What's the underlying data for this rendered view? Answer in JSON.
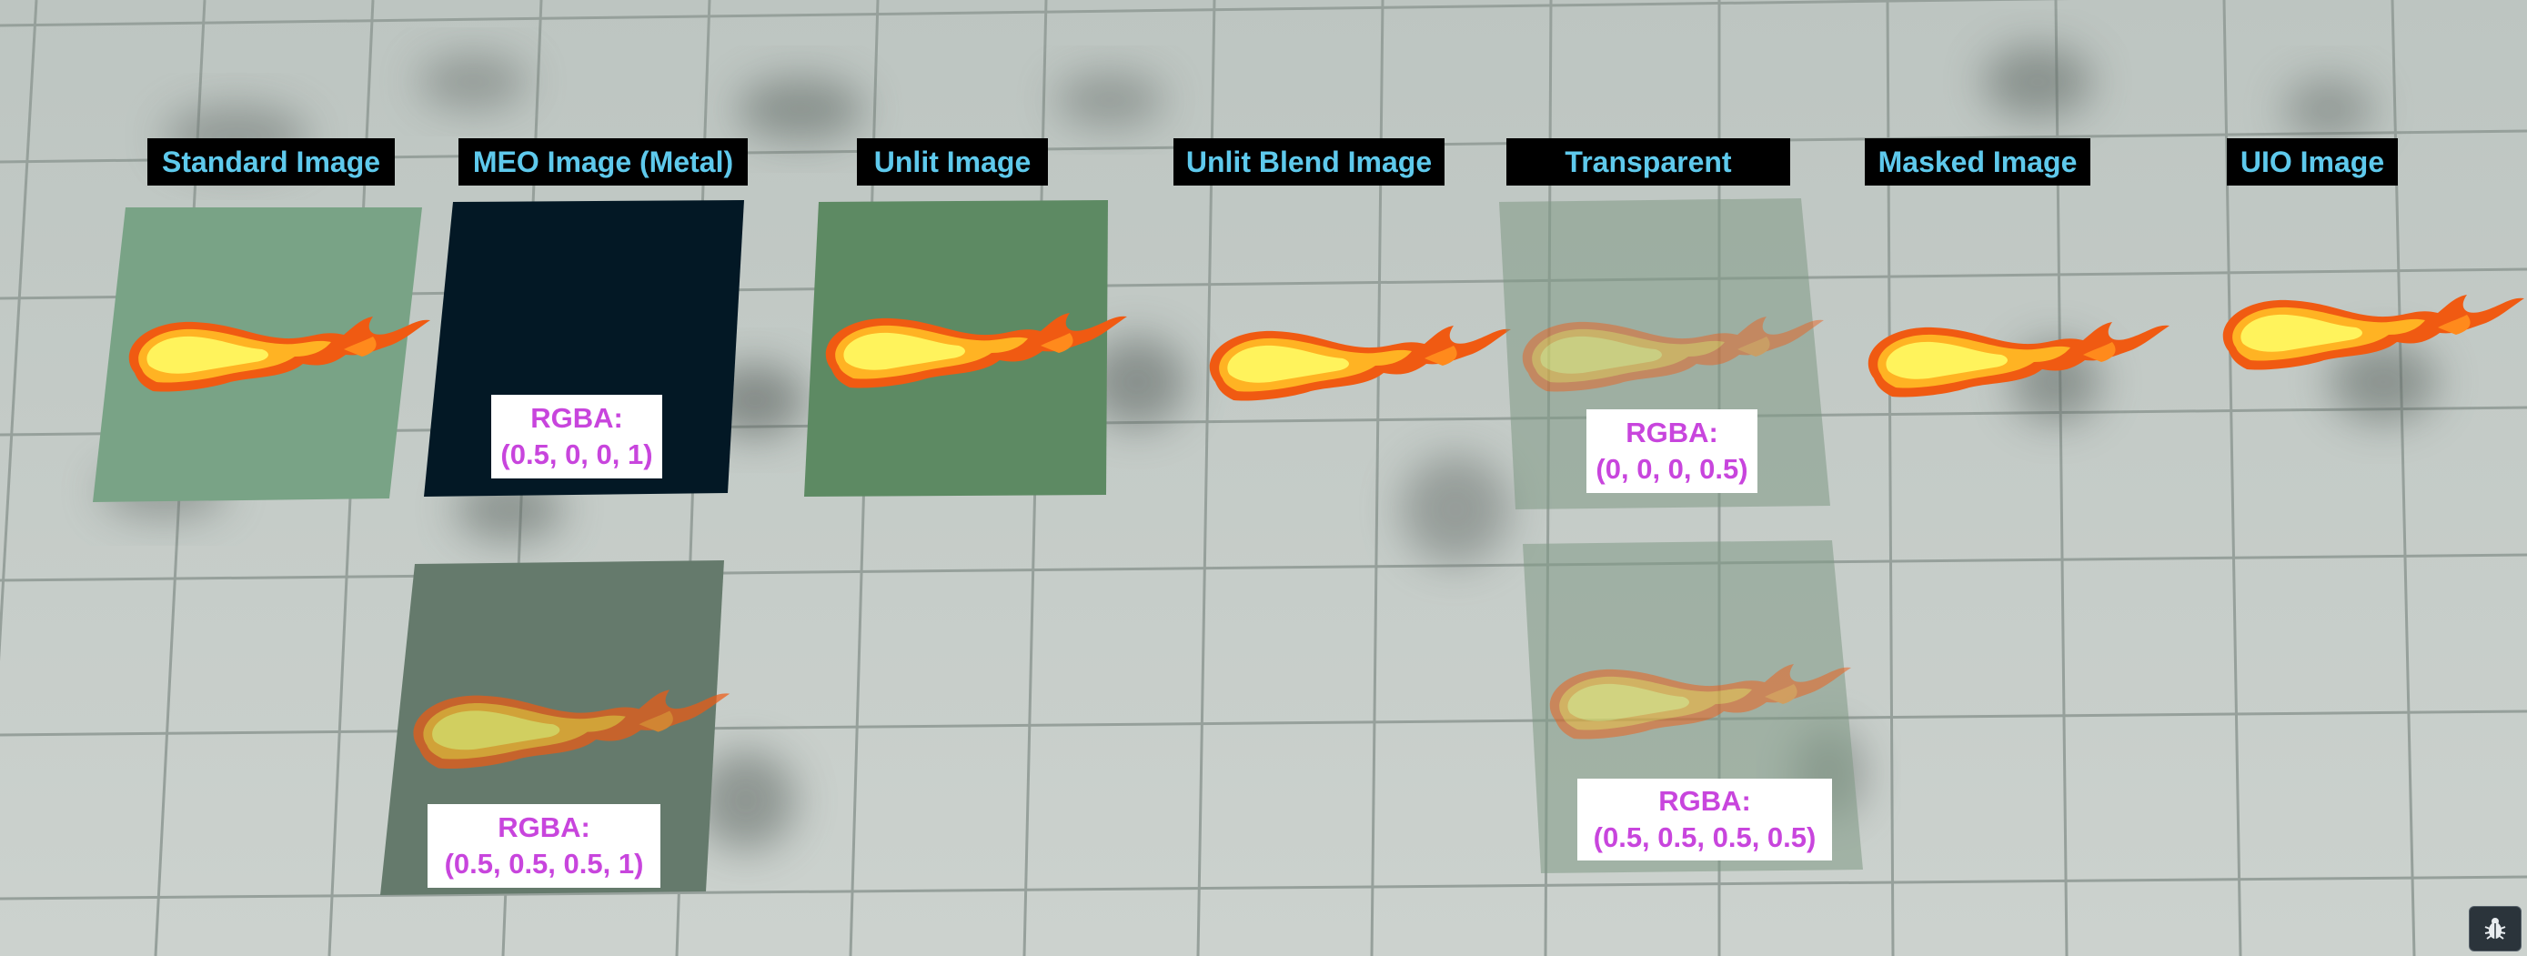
{
  "scene": {
    "titles": {
      "standard": "Standard Image",
      "meo": "MEO Image (Metal)",
      "unlit": "Unlit Image",
      "unlit_blend": "Unlit Blend Image",
      "transparent": "Transparent",
      "masked": "Masked Image",
      "uio": "UIO Image"
    },
    "rgba_labels": {
      "meo_top": {
        "line1": "RGBA:",
        "line2": "(0.5, 0, 0, 1)"
      },
      "meo_bottom": {
        "line1": "RGBA:",
        "line2": "(0.5, 0.5, 0.5, 1)"
      },
      "transparent_top": {
        "line1": "RGBA:",
        "line2": "(0, 0, 0, 0.5)"
      },
      "transparent_bottom": {
        "line1": "RGBA:",
        "line2": "(0.5, 0.5, 0.5, 0.5)"
      }
    }
  },
  "colors": {
    "ground": "#c5ccc8",
    "title_background": "#000000",
    "title_text": "#5ec9ec",
    "rgba_text": "#c845dd",
    "standard_panel": "#79a386",
    "meo_panel": "#031825",
    "unlit_panel": "#5d8a63",
    "fire_outer": "#ff6f12",
    "fire_inner": "#fff45a"
  },
  "toolbar": {
    "debug_icon": "bug-icon"
  }
}
